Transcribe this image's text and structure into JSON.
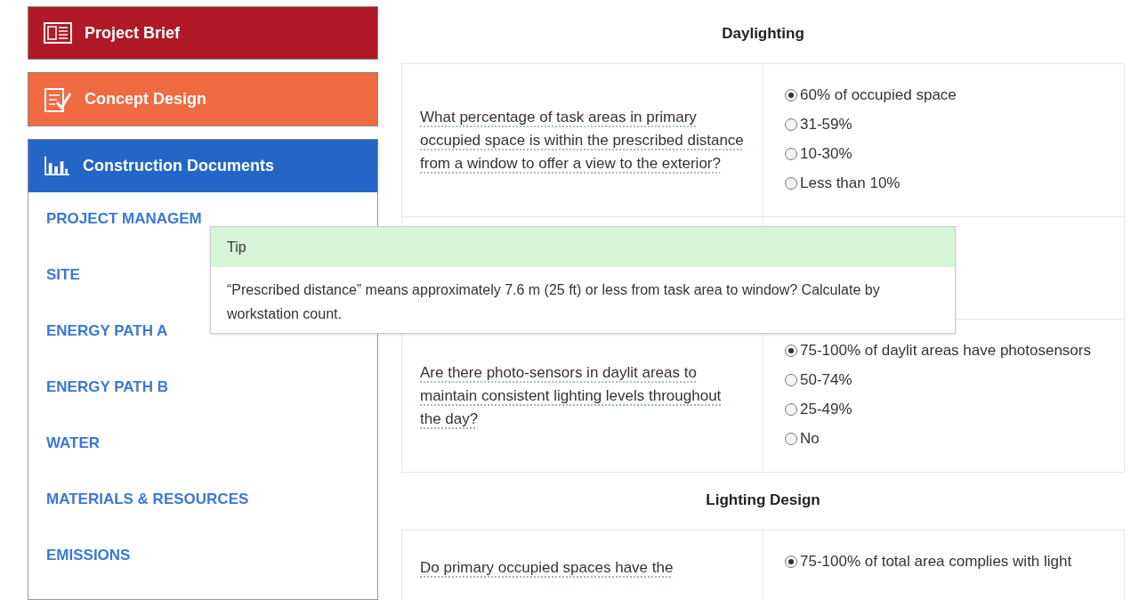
{
  "sidebar": {
    "phases": [
      {
        "label": "Project Brief",
        "kind": "brief",
        "color": "#b01a28"
      },
      {
        "label": "Concept Design",
        "kind": "concept",
        "color": "#f06a42"
      },
      {
        "label": "Construction Documents",
        "kind": "construction",
        "color": "#2466c6"
      }
    ],
    "items": [
      {
        "label": "PROJECT MANAGEM"
      },
      {
        "label": "SITE"
      },
      {
        "label": "ENERGY PATH A"
      },
      {
        "label": "ENERGY PATH B"
      },
      {
        "label": "WATER"
      },
      {
        "label": "MATERIALS & RESOURCES"
      },
      {
        "label": "EMISSIONS"
      }
    ]
  },
  "sections": [
    {
      "title": "Daylighting",
      "questions": [
        {
          "text": "What percentage of task areas in primary occupied space is within the prescribed distance from a window to offer a view to the exterior?",
          "options": [
            {
              "label": "60% of occupied space",
              "selected": true
            },
            {
              "label": "31-59%",
              "selected": false
            },
            {
              "label": "10-30%",
              "selected": false
            },
            {
              "label": "Less than 10%",
              "selected": false
            }
          ]
        },
        {
          "kind": "hidden"
        },
        {
          "text": "Are there photo-sensors in daylit areas to maintain consistent lighting levels throughout the day?",
          "options": [
            {
              "label": "75-100% of daylit areas have photosensors",
              "selected": true
            },
            {
              "label": "50-74%",
              "selected": false
            },
            {
              "label": "25-49%",
              "selected": false
            },
            {
              "label": "No",
              "selected": false
            }
          ]
        }
      ]
    },
    {
      "title": "Lighting Design",
      "questions": [
        {
          "text": "Do primary occupied spaces have the",
          "options": [
            {
              "label": "75-100% of total area complies with light",
              "selected": true
            }
          ]
        }
      ]
    }
  ],
  "tooltip": {
    "title": "Tip",
    "body": "“Prescribed distance” means approximately 7.6 m (25 ft) or less from task area to window? Calculate by workstation count."
  }
}
